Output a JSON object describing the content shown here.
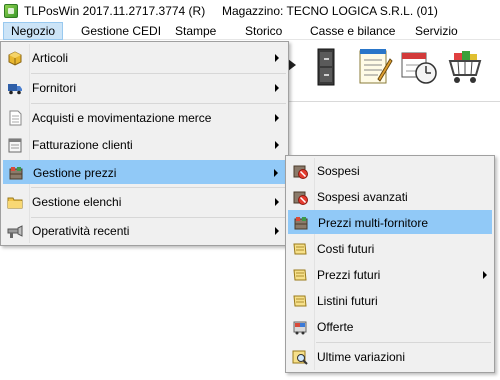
{
  "window": {
    "title": "TLPosWin 2017.11.2717.3774 (R)",
    "store": "Magazzino: TECNO LOGICA S.R.L. (01)"
  },
  "menubar": {
    "items": [
      "Negozio",
      "Gestione CEDI",
      "Stampe",
      "Storico",
      "Casse e bilance",
      "Servizio"
    ],
    "active": "Negozio"
  },
  "toolbar": {
    "icons": [
      "cabinet-icon",
      "notepad-icon",
      "calendar-clock-icon",
      "shopping-cart-icon"
    ]
  },
  "dropdown": {
    "items": [
      {
        "label": "Articoli",
        "icon": "box-icon",
        "has_submenu": true
      },
      {
        "label": "Fornitori",
        "icon": "truck-icon",
        "has_submenu": true
      },
      {
        "label": "Acquisti e movimentazione merce",
        "icon": "document-icon",
        "has_submenu": true
      },
      {
        "label": "Fatturazione clienti",
        "icon": "invoice-icon",
        "has_submenu": true
      },
      {
        "label": "Gestione prezzi",
        "icon": "price-tags-icon",
        "has_submenu": true,
        "highlighted": true
      },
      {
        "label": "Gestione elenchi",
        "icon": "folder-icon",
        "has_submenu": true
      },
      {
        "label": "Operatività recenti",
        "icon": "tools-icon",
        "has_submenu": true
      }
    ]
  },
  "submenu": {
    "items": [
      {
        "label": "Sospesi",
        "icon": "sospesi-icon"
      },
      {
        "label": "Sospesi avanzati",
        "icon": "sospesi-avanzati-icon"
      },
      {
        "label": "Prezzi multi-fornitore",
        "icon": "multi-supplier-icon",
        "highlighted": true
      },
      {
        "label": "Costi futuri",
        "icon": "costs-icon"
      },
      {
        "label": "Prezzi futuri",
        "icon": "future-prices-icon",
        "has_submenu": true
      },
      {
        "label": "Listini futuri",
        "icon": "price-list-icon"
      },
      {
        "label": "Offerte",
        "icon": "offers-icon"
      },
      {
        "label": "Ultime variazioni",
        "icon": "magnifier-icon"
      }
    ]
  },
  "colors": {
    "highlight": "#91c9f7",
    "menu_bg": "#f0f0f0",
    "active_menu": "#cce4f7"
  }
}
